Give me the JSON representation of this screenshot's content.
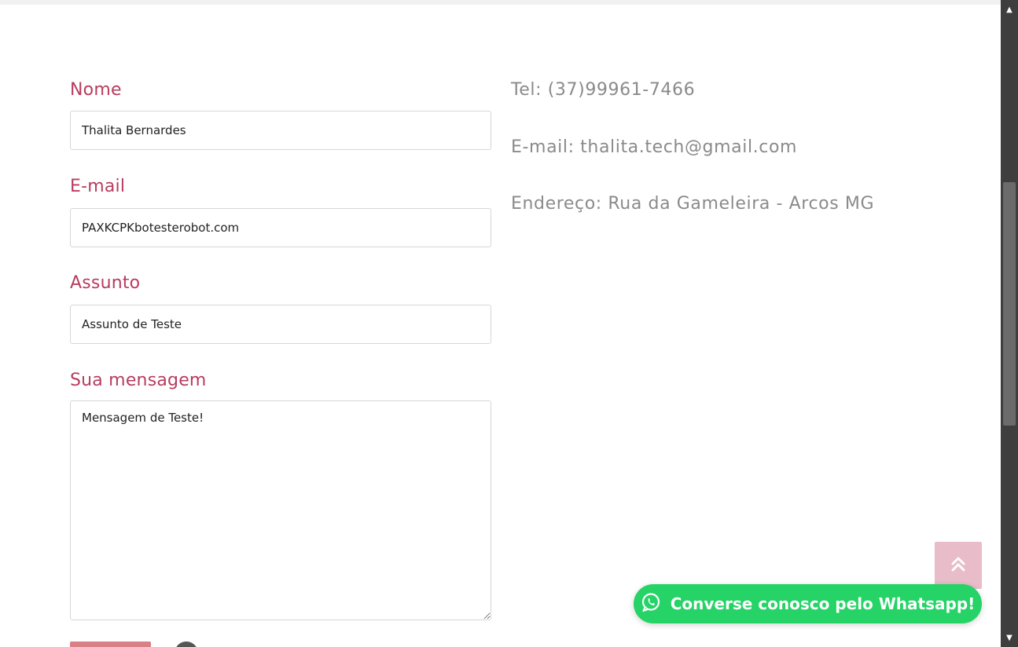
{
  "form": {
    "name_label": "Nome",
    "name_value": "Thalita Bernardes",
    "email_label": "E-mail",
    "email_value": "PAXKCPKbotesterobot.com",
    "subject_label": "Assunto",
    "subject_value": "Assunto de Teste",
    "message_label": "Sua mensagem",
    "message_value": "Mensagem de Teste!"
  },
  "contact": {
    "phone": "Tel: (37)99961-7466",
    "email": "E-mail: thalita.tech@gmail.com",
    "address": "Endereço: Rua da Gameleira - Arcos MG"
  },
  "whatsapp": {
    "label": "Converse conosco pelo Whatsapp!",
    "icon": "whatsapp-icon",
    "color": "#25d366"
  },
  "back_to_top": {
    "icon": "double-chevron-up-icon",
    "color": "#e8bcc9"
  },
  "colors": {
    "label": "#b83c5e",
    "info_text": "#8a8a8a"
  }
}
